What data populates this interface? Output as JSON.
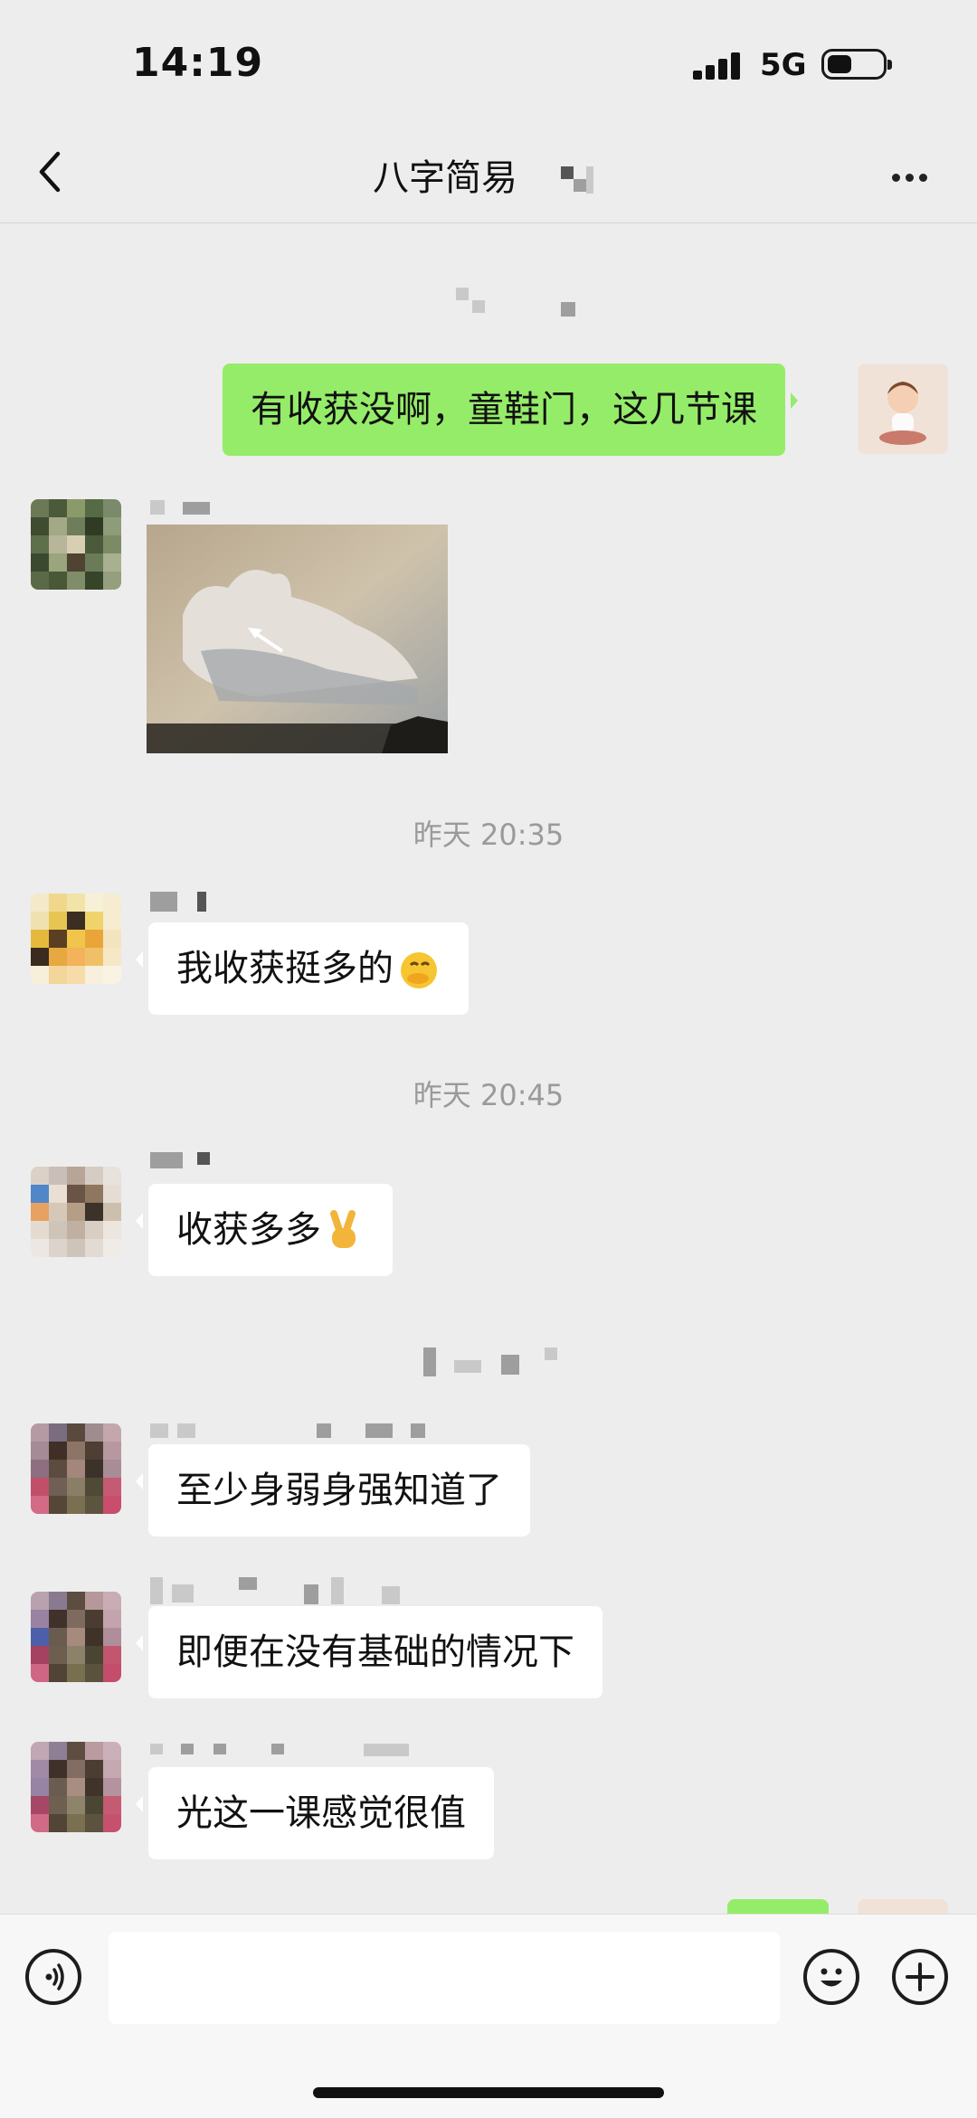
{
  "status_bar": {
    "time": "14:19",
    "network": "5G"
  },
  "header": {
    "title": "八字简易"
  },
  "messages": [
    {
      "type": "text",
      "direction": "out",
      "text": "有收获没啊，童鞋门，这几节课"
    },
    {
      "type": "image",
      "direction": "in"
    },
    {
      "type": "time",
      "text": "昨天 20:35"
    },
    {
      "type": "text",
      "direction": "in",
      "text": "我收获挺多的"
    },
    {
      "type": "time",
      "text": "昨天 20:45"
    },
    {
      "type": "text",
      "direction": "in",
      "text": "收获多多"
    },
    {
      "type": "text",
      "direction": "in",
      "text": "至少身弱身强知道了"
    },
    {
      "type": "text",
      "direction": "in",
      "text": "即便在没有基础的情况下"
    },
    {
      "type": "text",
      "direction": "in",
      "text": "光这一课感觉很值"
    }
  ],
  "input_bar": {
    "placeholder": ""
  },
  "icons": {
    "back": "chevron-left-icon",
    "more": "more-dots-icon",
    "voice": "voice-icon",
    "emoji": "emoji-icon",
    "add": "plus-icon"
  },
  "colors": {
    "outgoing_bubble": "#95ec69",
    "incoming_bubble": "#ffffff",
    "background": "#ededed"
  }
}
